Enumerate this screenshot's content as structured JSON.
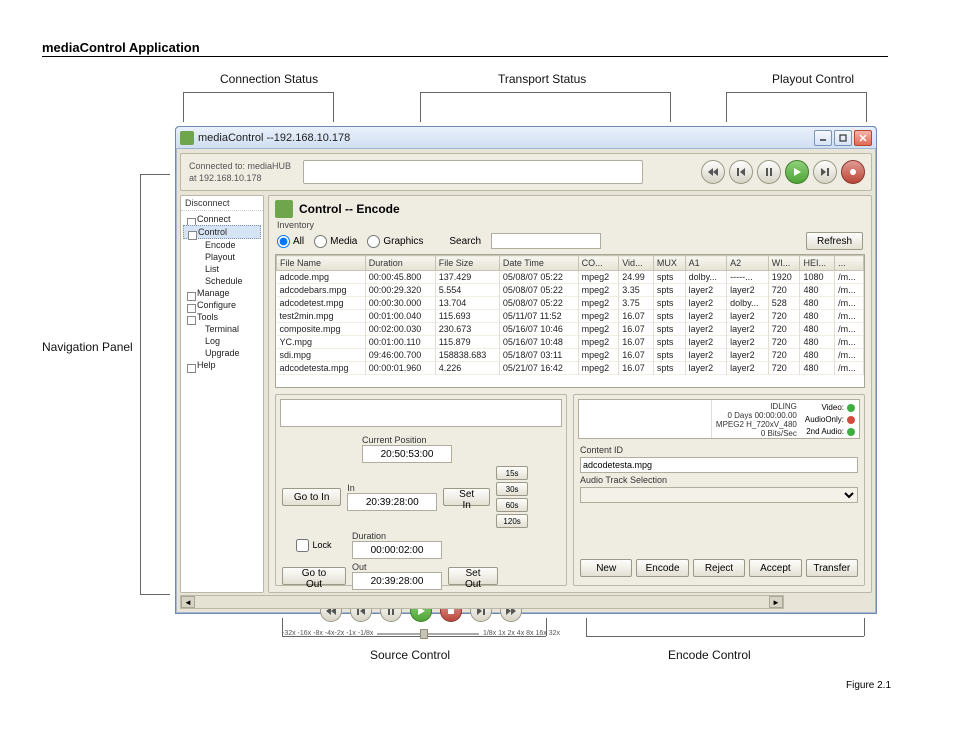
{
  "page_title": "mediaControl Application",
  "figure_label": "Figure 2.1",
  "callouts": {
    "connection_status": "Connection Status",
    "transport_status": "Transport Status",
    "playout_control": "Playout Control",
    "navigation_panel": "Navigation Panel",
    "source_control": "Source Control",
    "encode_control": "Encode Control"
  },
  "window": {
    "title": "mediaControl --192.168.10.178",
    "connected_to_label": "Connected to: mediaHUB",
    "connected_at": "at 192.168.10.178"
  },
  "nav": {
    "disconnect": "Disconnect",
    "items": [
      {
        "label": "Connect",
        "icon": "connect"
      },
      {
        "label": "Control",
        "icon": "control",
        "selected": true,
        "children": [
          {
            "label": "Encode"
          },
          {
            "label": "Playout"
          },
          {
            "label": "List"
          },
          {
            "label": "Schedule"
          }
        ]
      },
      {
        "label": "Manage",
        "icon": "manage"
      },
      {
        "label": "Configure",
        "icon": "configure"
      },
      {
        "label": "Tools",
        "icon": "tools",
        "children": [
          {
            "label": "Terminal"
          },
          {
            "label": "Log"
          },
          {
            "label": "Upgrade"
          }
        ]
      },
      {
        "label": "Help",
        "icon": "help"
      }
    ]
  },
  "main": {
    "title": "Control -- Encode",
    "inventory_label": "Inventory",
    "filters": {
      "all": "All",
      "media": "Media",
      "graphics": "Graphics",
      "search_label": "Search",
      "search_value": "",
      "refresh": "Refresh"
    },
    "columns": [
      "File Name",
      "Duration",
      "File Size",
      "Date Time",
      "CO...",
      "Vid...",
      "MUX",
      "A1",
      "A2",
      "WI...",
      "HEI...",
      "..."
    ],
    "rows": [
      [
        "adcode.mpg",
        "00:00:45.800",
        "137.429",
        "05/08/07 05:22",
        "mpeg2",
        "24.99",
        "spts",
        "dolby...",
        "-----...",
        "1920",
        "1080",
        "/m..."
      ],
      [
        "adcodebars.mpg",
        "00:00:29.320",
        "5.554",
        "05/08/07 05:22",
        "mpeg2",
        "3.35",
        "spts",
        "layer2",
        "layer2",
        "720",
        "480",
        "/m..."
      ],
      [
        "adcodetest.mpg",
        "00:00:30.000",
        "13.704",
        "05/08/07 05:22",
        "mpeg2",
        "3.75",
        "spts",
        "layer2",
        "dolby...",
        "528",
        "480",
        "/m..."
      ],
      [
        "test2min.mpg",
        "00:01:00.040",
        "115.693",
        "05/11/07 11:52",
        "mpeg2",
        "16.07",
        "spts",
        "layer2",
        "layer2",
        "720",
        "480",
        "/m..."
      ],
      [
        "composite.mpg",
        "00:02:00.030",
        "230.673",
        "05/16/07 10:46",
        "mpeg2",
        "16.07",
        "spts",
        "layer2",
        "layer2",
        "720",
        "480",
        "/m..."
      ],
      [
        "YC.mpg",
        "00:01:00.110",
        "115.879",
        "05/16/07 10:48",
        "mpeg2",
        "16.07",
        "spts",
        "layer2",
        "layer2",
        "720",
        "480",
        "/m..."
      ],
      [
        "sdi.mpg",
        "09:46:00.700",
        "158838.683",
        "05/18/07 03:11",
        "mpeg2",
        "16.07",
        "spts",
        "layer2",
        "layer2",
        "720",
        "480",
        "/m..."
      ],
      [
        "adcodetesta.mpg",
        "00:00:01.960",
        "4.226",
        "05/21/07 16:42",
        "mpeg2",
        "16.07",
        "spts",
        "layer2",
        "layer2",
        "720",
        "480",
        "/m..."
      ]
    ]
  },
  "source": {
    "current_position_label": "Current Position",
    "current_position": "20:50:53:00",
    "in_label": "In",
    "in_value": "20:39:28:00",
    "duration_label": "Duration",
    "duration_value": "00:00:02:00",
    "out_label": "Out",
    "out_value": "20:39:28:00",
    "go_to_in": "Go to In",
    "go_to_out": "Go to Out",
    "set_in": "Set In",
    "set_out": "Set Out",
    "lock": "Lock",
    "quick": [
      "15s",
      "30s",
      "60s",
      "120s"
    ],
    "speed_left": "-32x -16x -8x -4x-2x -1x -1/8x",
    "speed_right": "1/8x  1x  2x  4x  8x 16x 32x"
  },
  "status": {
    "state": "IDLING",
    "elapsed": "0 Days 00:00:00.00",
    "format": "MPEG2 H_720xV_480",
    "bitrate": "0 Bits/Sec",
    "video_label": "Video:",
    "audio_only_label": "AudioOnly:",
    "second_audio_label": "2nd Audio:"
  },
  "encode": {
    "content_id_label": "Content ID",
    "content_id": "adcodetesta.mpg",
    "audio_track_label": "Audio Track Selection",
    "buttons": {
      "new": "New",
      "encode": "Encode",
      "reject": "Reject",
      "accept": "Accept",
      "transfer": "Transfer"
    }
  }
}
